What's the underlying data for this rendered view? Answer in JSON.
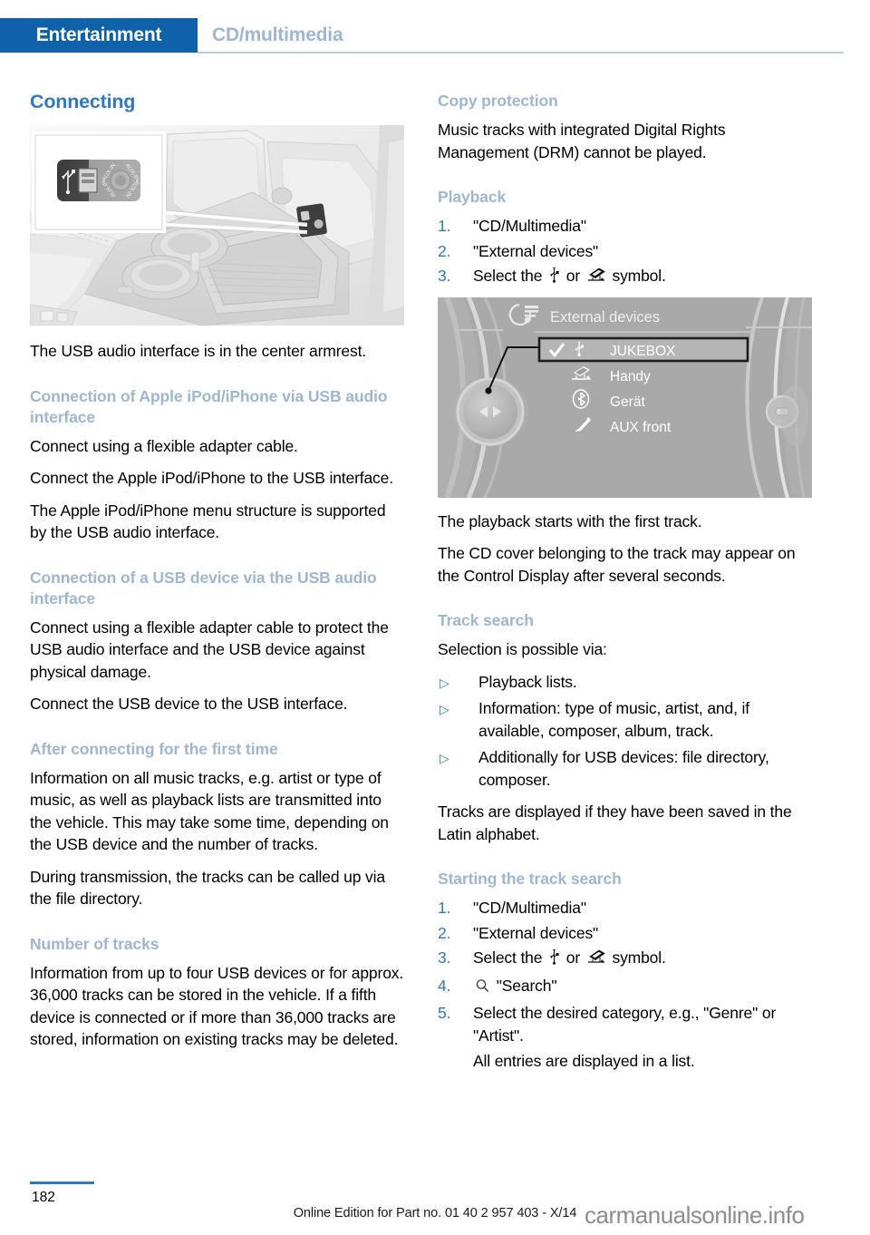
{
  "header": {
    "active_tab": "Entertainment",
    "inactive_tab": "CD/multimedia",
    "accent_blue": "#0f61a9",
    "muted_blue": "#9fb6d3"
  },
  "left_column": {
    "heading": "Connecting",
    "figure_console": {
      "caption_labels": [
        "USB",
        "AUX-IN"
      ],
      "icon_names": [
        "usb-icon",
        "aux-in-jack-icon"
      ]
    },
    "intro": "The USB audio interface is in the center armrest.",
    "sections": [
      {
        "subheading": "Connection of Apple iPod/iPhone via USB audio interface",
        "paragraphs": [
          "Connect using a flexible adapter cable.",
          "Connect the Apple iPod/iPhone to the USB interface.",
          "The Apple iPod/iPhone menu structure is supported by the USB audio interface."
        ]
      },
      {
        "subheading": "Connection of a USB device via the USB audio interface",
        "paragraphs": [
          "Connect using a flexible adapter cable to protect the USB audio interface and the USB device against physical damage.",
          "Connect the USB device to the USB interface."
        ]
      },
      {
        "subheading": "After connecting for the first time",
        "paragraphs": [
          "Information on all music tracks, e.g. artist or type of music, as well as playback lists are transmitted into the vehicle. This may take some time, depending on the USB device and the number of tracks.",
          "During transmission, the tracks can be called up via the file directory."
        ]
      },
      {
        "subheading": "Number of tracks",
        "paragraphs": [
          "Information from up to four USB devices or for approx. 36,000 tracks can be stored in the vehicle. If a fifth device is connected or if more than 36,000 tracks are stored, information on existing tracks may be deleted."
        ]
      }
    ]
  },
  "right_column": {
    "copy_protection": {
      "subheading": "Copy protection",
      "paragraph": "Music tracks with integrated Digital Rights Management (DRM) cannot be played."
    },
    "playback": {
      "subheading": "Playback",
      "steps": [
        {
          "num": "1.",
          "text": "\"CD/Multimedia\""
        },
        {
          "num": "2.",
          "text": "\"External devices\""
        },
        {
          "num": "3.",
          "text_before": "Select the",
          "text_middle": "or",
          "text_after": "symbol."
        }
      ]
    },
    "idrive_screen": {
      "title": "External devices",
      "title_icon": "multimedia-note-icon",
      "items": [
        {
          "label": "JUKEBOX",
          "icon": "usb-icon",
          "checked": true,
          "highlighted": true
        },
        {
          "label": "Handy",
          "icon": "phone-cradle-icon",
          "checked": false,
          "highlighted": false
        },
        {
          "label": "Gerät",
          "icon": "bluetooth-icon",
          "checked": false,
          "highlighted": false
        },
        {
          "label": "AUX front",
          "icon": "aux-plug-icon",
          "checked": false,
          "highlighted": false
        }
      ]
    },
    "after_screen_paragraphs": [
      "The playback starts with the first track.",
      "The CD cover belonging to the track may appear on the Control Display after several seconds."
    ],
    "track_search": {
      "subheading": "Track search",
      "intro": "Selection is possible via:",
      "bullets": [
        "Playback lists.",
        "Information: type of music, artist, and, if available, composer, album, track.",
        "Additionally for USB devices: file directory, composer."
      ],
      "closing": "Tracks are displayed if they have been saved in the Latin alphabet."
    },
    "starting_track_search": {
      "subheading": "Starting the track search",
      "steps": [
        {
          "num": "1.",
          "text": "\"CD/Multimedia\""
        },
        {
          "num": "2.",
          "text": "\"External devices\""
        },
        {
          "num": "3.",
          "text_before": "Select the",
          "text_middle": "or",
          "text_after": "symbol."
        },
        {
          "num": "4.",
          "text": "\"Search\"",
          "icon": "magnifier-icon"
        },
        {
          "num": "5.",
          "text": "Select the desired category, e.g., \"Genre\" or \"Artist\".",
          "sub": "All entries are displayed in a list."
        }
      ]
    }
  },
  "footer": {
    "page_number": "182",
    "edition_note": "Online Edition for Part no. 01 40 2 957 403 - X/14",
    "watermark": "carmanualsonline.info"
  }
}
